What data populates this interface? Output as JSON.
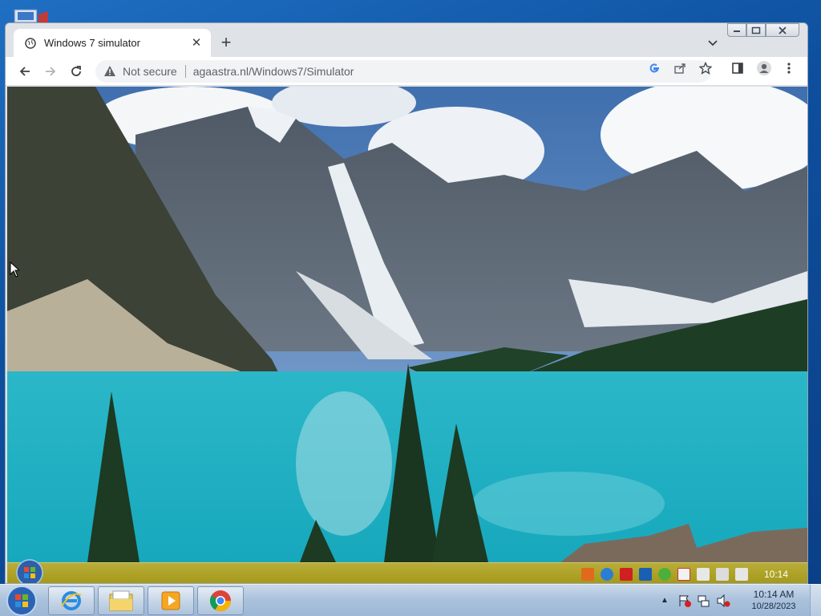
{
  "browser": {
    "tab": {
      "title": "Windows 7 simulator",
      "close_glyph": "✕"
    },
    "newtab_glyph": "+",
    "address": {
      "security_label": "Not secure",
      "url": "agaastra.nl/Windows7/Simulator"
    },
    "icons": [
      "back-arrow-icon",
      "forward-arrow-icon",
      "reload-icon",
      "warning-icon",
      "google-icon",
      "share-icon",
      "star-icon",
      "side-panel-icon",
      "profile-icon",
      "menu-dots-icon"
    ]
  },
  "simulator": {
    "clock": "10:14",
    "tray_icons": [
      "calculator-icon",
      "ie-icon",
      "pdf-icon",
      "outlook-icon",
      "shield-check-icon",
      "flag-icon",
      "device-icon",
      "network-icon",
      "volume-icon"
    ]
  },
  "taskbar": {
    "apps": [
      "internet-explorer-icon",
      "folder-icon",
      "media-player-icon",
      "chrome-icon"
    ],
    "clock": {
      "time": "10:14 AM",
      "date": "10/28/2023"
    }
  },
  "colors": {
    "lake": "#1fb0c4",
    "sky": "#3d6fb0",
    "sim_taskbar": "#aea21f",
    "win_taskbar": "#b0c7e0"
  }
}
